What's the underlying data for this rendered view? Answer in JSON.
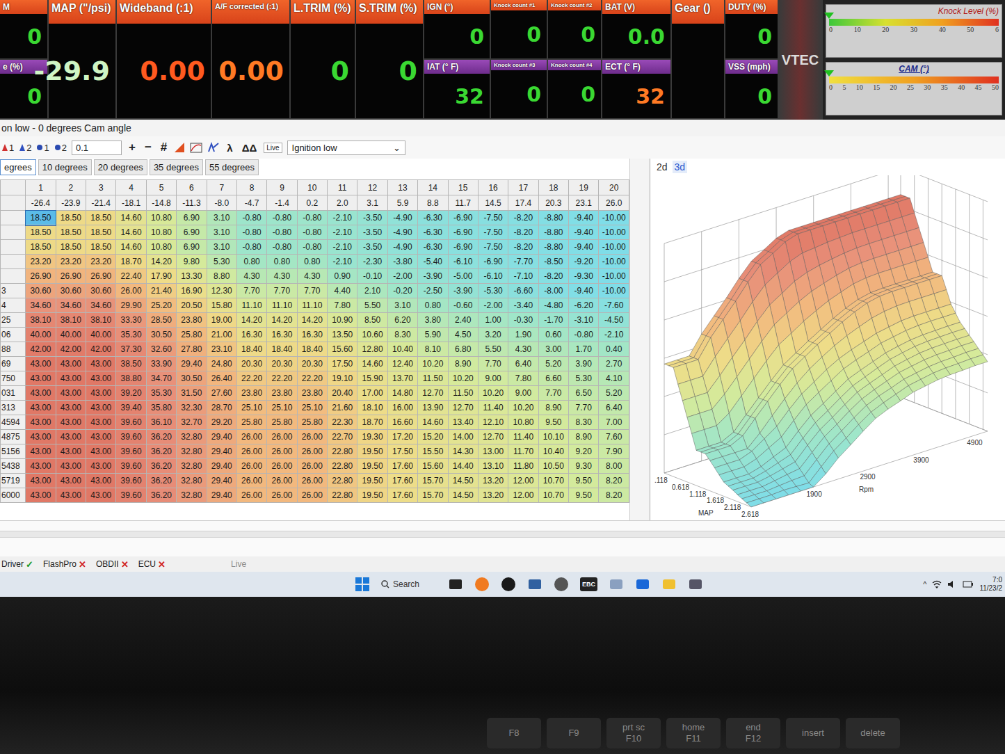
{
  "window": {
    "title": "on low - 0 degrees Cam angle"
  },
  "gauges": [
    {
      "cells": [
        {
          "label": "M",
          "value": "0",
          "color": "#3ad832"
        },
        {
          "label": "e (%)",
          "value": "0",
          "color": "#3ad832"
        }
      ]
    },
    {
      "cells": [
        {
          "label": "MAP (\"/psi)",
          "value": "-29.9",
          "color": "#cff5c4"
        }
      ]
    },
    {
      "cells": [
        {
          "label": "Wideband (:1)",
          "value": "0.00",
          "color": "#ff5a1f"
        }
      ]
    },
    {
      "cells": [
        {
          "label": "A/F corrected (:1)",
          "value": "0.00",
          "color": "#ff7a24"
        }
      ]
    },
    {
      "cells": [
        {
          "label": "L.TRIM (%)",
          "value": "0",
          "color": "#3ad832"
        }
      ]
    },
    {
      "cells": [
        {
          "label": "S.TRIM (%)",
          "value": "0",
          "color": "#3ad832"
        }
      ]
    },
    {
      "cells": [
        {
          "label": "IGN (°)",
          "value": "0",
          "color": "#3ad832"
        },
        {
          "label": "IAT (° F)",
          "value": "32",
          "color": "#3ad832"
        }
      ]
    },
    {
      "cells": [
        {
          "label": "Knock count #1",
          "value": "0",
          "color": "#3ad832"
        },
        {
          "label": "Knock count #3",
          "value": "0",
          "color": "#3ad832"
        }
      ]
    },
    {
      "cells": [
        {
          "label": "Knock count #2",
          "value": "0",
          "color": "#3ad832"
        },
        {
          "label": "Knock count #4",
          "value": "0",
          "color": "#3ad832"
        }
      ]
    },
    {
      "cells": [
        {
          "label": "BAT (V)",
          "value": "0.0",
          "color": "#3ad832"
        },
        {
          "label": "ECT (° F)",
          "value": "32",
          "color": "#ff7a24"
        }
      ]
    },
    {
      "cells": [
        {
          "label": "Gear ()"
        }
      ]
    },
    {
      "cells": [
        {
          "label": "DUTY (%)",
          "value": "0",
          "color": "#3ad832"
        },
        {
          "label": "VSS (mph)",
          "value": "0",
          "color": "#3ad832"
        }
      ]
    }
  ],
  "vtec": {
    "label": "VTEC",
    "on": false
  },
  "bars": [
    {
      "label": "Knock Level (%)",
      "level": 0,
      "ticks": [
        "0",
        "10",
        "20",
        "30",
        "40",
        "50",
        "6"
      ]
    },
    {
      "label": "CAM (°)",
      "level": 0,
      "ticks": [
        "0",
        "5",
        "10",
        "15",
        "20",
        "25",
        "30",
        "35",
        "40",
        "45",
        "50"
      ]
    }
  ],
  "toolbar": {
    "markers": [
      "1",
      "2",
      "1",
      "2"
    ],
    "step": "0.1",
    "buttons": [
      "+",
      "−",
      "#"
    ],
    "symbols": [
      "λ",
      "ΔΔ"
    ],
    "live": "Live",
    "dropdown": {
      "value": "Ignition low",
      "arrow": "⌄"
    }
  },
  "tabs": [
    {
      "label": "egrees",
      "selected": true
    },
    {
      "label": "10 degrees",
      "selected": false
    },
    {
      "label": "20 degrees",
      "selected": false
    },
    {
      "label": "35 degrees",
      "selected": false
    },
    {
      "label": "55 degrees",
      "selected": false
    }
  ],
  "table": {
    "columns": [
      "1",
      "2",
      "3",
      "4",
      "5",
      "6",
      "7",
      "8",
      "9",
      "10",
      "11",
      "12",
      "13",
      "14",
      "15",
      "16",
      "17",
      "18",
      "19",
      "20"
    ],
    "map_values": [
      "-26.4",
      "-23.9",
      "-21.4",
      "-18.1",
      "-14.8",
      "-11.3",
      "-8.0",
      "-4.7",
      "-1.4",
      "0.2",
      "2.0",
      "3.1",
      "5.9",
      "8.8",
      "11.7",
      "14.5",
      "17.4",
      "20.3",
      "23.1",
      "26.0"
    ],
    "selection": {
      "row": 0,
      "col": 0
    },
    "rows": [
      {
        "label": "",
        "cells": [
          "18.50",
          "18.50",
          "18.50",
          "14.60",
          "10.80",
          "6.90",
          "3.10",
          "-0.80",
          "-0.80",
          "-0.80",
          "-2.10",
          "-3.50",
          "-4.90",
          "-6.30",
          "-6.90",
          "-7.50",
          "-8.20",
          "-8.80",
          "-9.40",
          "-10.00"
        ]
      },
      {
        "label": "",
        "cells": [
          "18.50",
          "18.50",
          "18.50",
          "14.60",
          "10.80",
          "6.90",
          "3.10",
          "-0.80",
          "-0.80",
          "-0.80",
          "-2.10",
          "-3.50",
          "-4.90",
          "-6.30",
          "-6.90",
          "-7.50",
          "-8.20",
          "-8.80",
          "-9.40",
          "-10.00"
        ]
      },
      {
        "label": "",
        "cells": [
          "18.50",
          "18.50",
          "18.50",
          "14.60",
          "10.80",
          "6.90",
          "3.10",
          "-0.80",
          "-0.80",
          "-0.80",
          "-2.10",
          "-3.50",
          "-4.90",
          "-6.30",
          "-6.90",
          "-7.50",
          "-8.20",
          "-8.80",
          "-9.40",
          "-10.00"
        ]
      },
      {
        "label": "",
        "cells": [
          "23.20",
          "23.20",
          "23.20",
          "18.70",
          "14.20",
          "9.80",
          "5.30",
          "0.80",
          "0.80",
          "0.80",
          "-2.10",
          "-2.30",
          "-3.80",
          "-5.40",
          "-6.10",
          "-6.90",
          "-7.70",
          "-8.50",
          "-9.20",
          "-10.00"
        ]
      },
      {
        "label": "",
        "cells": [
          "26.90",
          "26.90",
          "26.90",
          "22.40",
          "17.90",
          "13.30",
          "8.80",
          "4.30",
          "4.30",
          "4.30",
          "0.90",
          "-0.10",
          "-2.00",
          "-3.90",
          "-5.00",
          "-6.10",
          "-7.10",
          "-8.20",
          "-9.30",
          "-10.00"
        ]
      },
      {
        "label": "3",
        "cells": [
          "30.60",
          "30.60",
          "30.60",
          "26.00",
          "21.40",
          "16.90",
          "12.30",
          "7.70",
          "7.70",
          "7.70",
          "4.40",
          "2.10",
          "-0.20",
          "-2.50",
          "-3.90",
          "-5.30",
          "-6.60",
          "-8.00",
          "-9.40",
          "-10.00"
        ]
      },
      {
        "label": "4",
        "cells": [
          "34.60",
          "34.60",
          "34.60",
          "29.90",
          "25.20",
          "20.50",
          "15.80",
          "11.10",
          "11.10",
          "11.10",
          "7.80",
          "5.50",
          "3.10",
          "0.80",
          "-0.60",
          "-2.00",
          "-3.40",
          "-4.80",
          "-6.20",
          "-7.60"
        ]
      },
      {
        "label": "25",
        "cells": [
          "38.10",
          "38.10",
          "38.10",
          "33.30",
          "28.50",
          "23.80",
          "19.00",
          "14.20",
          "14.20",
          "14.20",
          "10.90",
          "8.50",
          "6.20",
          "3.80",
          "2.40",
          "1.00",
          "-0.30",
          "-1.70",
          "-3.10",
          "-4.50"
        ]
      },
      {
        "label": "06",
        "cells": [
          "40.00",
          "40.00",
          "40.00",
          "35.30",
          "30.50",
          "25.80",
          "21.00",
          "16.30",
          "16.30",
          "16.30",
          "13.50",
          "10.60",
          "8.30",
          "5.90",
          "4.50",
          "3.20",
          "1.90",
          "0.60",
          "-0.80",
          "-2.10"
        ]
      },
      {
        "label": "88",
        "cells": [
          "42.00",
          "42.00",
          "42.00",
          "37.30",
          "32.60",
          "27.80",
          "23.10",
          "18.40",
          "18.40",
          "18.40",
          "15.60",
          "12.80",
          "10.40",
          "8.10",
          "6.80",
          "5.50",
          "4.30",
          "3.00",
          "1.70",
          "0.40"
        ]
      },
      {
        "label": "69",
        "cells": [
          "43.00",
          "43.00",
          "43.00",
          "38.50",
          "33.90",
          "29.40",
          "24.80",
          "20.30",
          "20.30",
          "20.30",
          "17.50",
          "14.60",
          "12.40",
          "10.20",
          "8.90",
          "7.70",
          "6.40",
          "5.20",
          "3.90",
          "2.70"
        ]
      },
      {
        "label": "750",
        "cells": [
          "43.00",
          "43.00",
          "43.00",
          "38.80",
          "34.70",
          "30.50",
          "26.40",
          "22.20",
          "22.20",
          "22.20",
          "19.10",
          "15.90",
          "13.70",
          "11.50",
          "10.20",
          "9.00",
          "7.80",
          "6.60",
          "5.30",
          "4.10"
        ]
      },
      {
        "label": "031",
        "cells": [
          "43.00",
          "43.00",
          "43.00",
          "39.20",
          "35.30",
          "31.50",
          "27.60",
          "23.80",
          "23.80",
          "23.80",
          "20.40",
          "17.00",
          "14.80",
          "12.70",
          "11.50",
          "10.20",
          "9.00",
          "7.70",
          "6.50",
          "5.20"
        ]
      },
      {
        "label": "313",
        "cells": [
          "43.00",
          "43.00",
          "43.00",
          "39.40",
          "35.80",
          "32.30",
          "28.70",
          "25.10",
          "25.10",
          "25.10",
          "21.60",
          "18.10",
          "16.00",
          "13.90",
          "12.70",
          "11.40",
          "10.20",
          "8.90",
          "7.70",
          "6.40"
        ]
      },
      {
        "label": "4594",
        "cells": [
          "43.00",
          "43.00",
          "43.00",
          "39.60",
          "36.10",
          "32.70",
          "29.20",
          "25.80",
          "25.80",
          "25.80",
          "22.30",
          "18.70",
          "16.60",
          "14.60",
          "13.40",
          "12.10",
          "10.80",
          "9.50",
          "8.30",
          "7.00"
        ]
      },
      {
        "label": "4875",
        "cells": [
          "43.00",
          "43.00",
          "43.00",
          "39.60",
          "36.20",
          "32.80",
          "29.40",
          "26.00",
          "26.00",
          "26.00",
          "22.70",
          "19.30",
          "17.20",
          "15.20",
          "14.00",
          "12.70",
          "11.40",
          "10.10",
          "8.90",
          "7.60"
        ]
      },
      {
        "label": "5156",
        "cells": [
          "43.00",
          "43.00",
          "43.00",
          "39.60",
          "36.20",
          "32.80",
          "29.40",
          "26.00",
          "26.00",
          "26.00",
          "22.80",
          "19.50",
          "17.50",
          "15.50",
          "14.30",
          "13.00",
          "11.70",
          "10.40",
          "9.20",
          "7.90"
        ]
      },
      {
        "label": "5438",
        "cells": [
          "43.00",
          "43.00",
          "43.00",
          "39.60",
          "36.20",
          "32.80",
          "29.40",
          "26.00",
          "26.00",
          "26.00",
          "22.80",
          "19.50",
          "17.60",
          "15.60",
          "14.40",
          "13.10",
          "11.80",
          "10.50",
          "9.30",
          "8.00"
        ]
      },
      {
        "label": "5719",
        "cells": [
          "43.00",
          "43.00",
          "43.00",
          "39.60",
          "36.20",
          "32.80",
          "29.40",
          "26.00",
          "26.00",
          "26.00",
          "22.80",
          "19.50",
          "17.60",
          "15.70",
          "14.50",
          "13.20",
          "12.00",
          "10.70",
          "9.50",
          "8.20"
        ]
      },
      {
        "label": "6000",
        "cells": [
          "43.00",
          "43.00",
          "43.00",
          "39.60",
          "36.20",
          "32.80",
          "29.40",
          "26.00",
          "26.00",
          "26.00",
          "22.80",
          "19.50",
          "17.60",
          "15.70",
          "14.50",
          "13.20",
          "12.00",
          "10.70",
          "9.50",
          "8.20"
        ]
      }
    ]
  },
  "view_tabs": [
    {
      "label": "2d",
      "selected": false
    },
    {
      "label": "3d",
      "selected": true
    }
  ],
  "chart": {
    "map_label": "MAP",
    "rpm_label": "Rpm",
    "map_ticks": [
      ".118",
      "0.618",
      "1.118",
      "1.618",
      "2.118",
      "2.618"
    ],
    "rpm_ticks": [
      "1900",
      "2900",
      "3900",
      "4900"
    ]
  },
  "statusbar": {
    "items": [
      {
        "label": "Driver",
        "ok": true,
        "glyph": "✓"
      },
      {
        "label": "FlashPro",
        "ok": false,
        "glyph": "✕"
      },
      {
        "label": "OBDII",
        "ok": false,
        "glyph": "✕"
      },
      {
        "label": "ECU",
        "ok": false,
        "glyph": "✕"
      }
    ],
    "live": "Live"
  },
  "taskbar": {
    "search": "Search",
    "ebc": "EBC",
    "tray_arrow": "^",
    "time": "7:0",
    "date": "11/23/2"
  },
  "keyboard": [
    {
      "top": "",
      "bottom": "F8"
    },
    {
      "top": "",
      "bottom": "F9"
    },
    {
      "top": "prt sc",
      "bottom": "F10"
    },
    {
      "top": "home",
      "bottom": "F11"
    },
    {
      "top": "end",
      "bottom": "F12"
    },
    {
      "top": "insert",
      "bottom": ""
    },
    {
      "top": "delete",
      "bottom": ""
    }
  ]
}
